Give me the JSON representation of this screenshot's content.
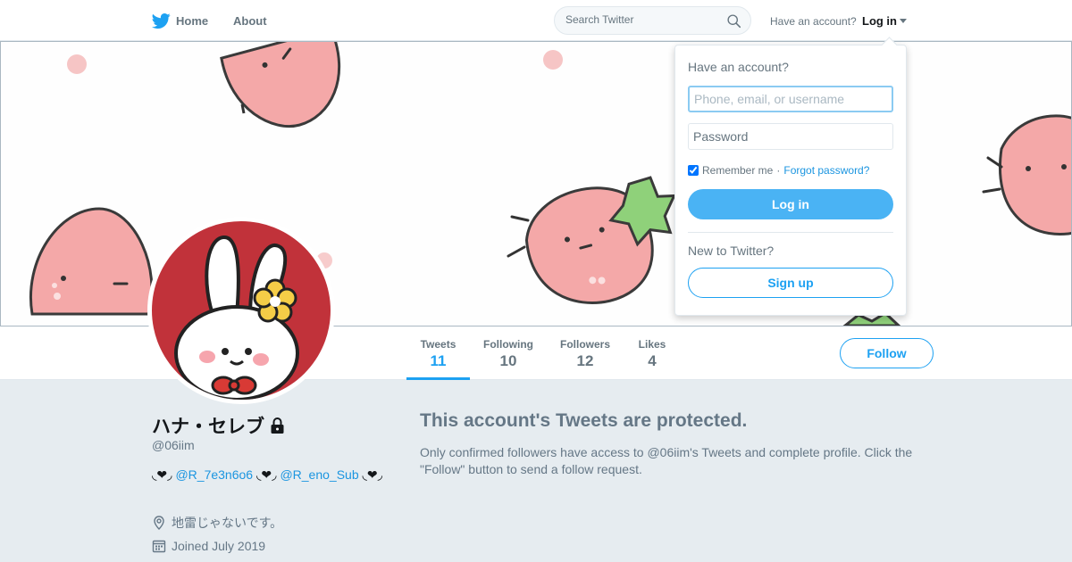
{
  "nav": {
    "home_label": "Home",
    "about_label": "About",
    "search_placeholder": "Search Twitter",
    "have_account": "Have an account?",
    "login_label": "Log in"
  },
  "colors": {
    "accent": "#1da1f2",
    "login_button": "#4ab3f4",
    "avatar_background": "#c1323a",
    "strawberry": "#f4a8a8"
  },
  "icons": [
    "twitter-bird-icon",
    "search-icon",
    "caret-down-icon",
    "lock-icon",
    "location-icon",
    "calendar-icon"
  ],
  "login_dropdown": {
    "heading": "Have an account?",
    "username_placeholder": "Phone, email, or username",
    "password_placeholder": "Password",
    "remember_label": "Remember me",
    "separator": "·",
    "forgot_label": "Forgot password?",
    "login_button": "Log in",
    "new_prompt": "New to Twitter?",
    "signup_button": "Sign up"
  },
  "profile_nav": {
    "stats": [
      {
        "label": "Tweets",
        "value": "11"
      },
      {
        "label": "Following",
        "value": "10"
      },
      {
        "label": "Followers",
        "value": "12"
      },
      {
        "label": "Likes",
        "value": "4"
      }
    ],
    "follow_label": "Follow"
  },
  "profile": {
    "name": "ハナ・セレブ",
    "handle": "@06iim",
    "bio": {
      "heart": "◟❤︎◞",
      "mention1": "@R_7e3n6o6",
      "mention2": "@R_eno_Sub"
    },
    "location": "地雷じゃないです。",
    "joined": "Joined July 2019"
  },
  "protected": {
    "title": "This account's Tweets are protected.",
    "text": "Only confirmed followers have access to @06iim's Tweets and complete profile. Click the \"Follow\" button to send a follow request."
  }
}
